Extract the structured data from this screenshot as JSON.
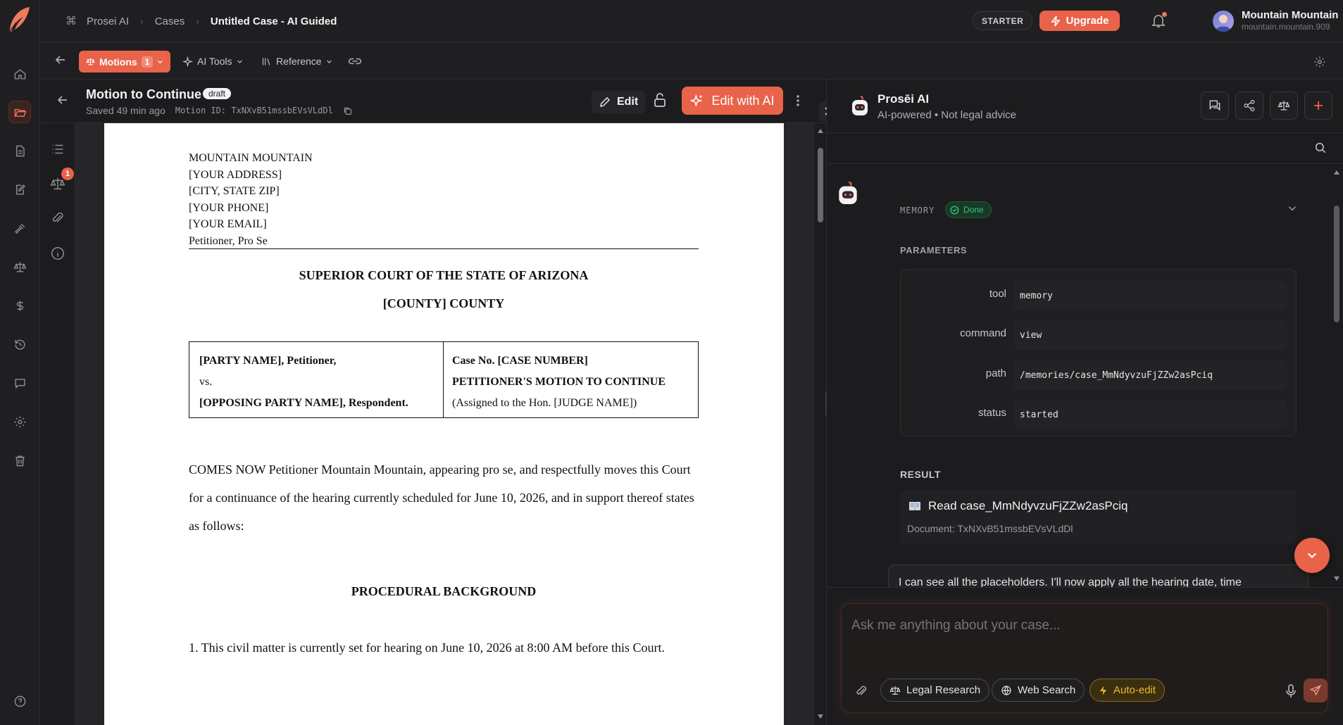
{
  "topbar": {
    "breadcrumbs": [
      "Prosei AI",
      "Cases",
      "Untitled Case - AI Guided"
    ],
    "plan_badge": "STARTER",
    "upgrade_label": "Upgrade",
    "user_name": "Mountain Mountain",
    "user_email": "mountain.mountain.909"
  },
  "toolbar": {
    "motions_label": "Motions",
    "motions_count": "1",
    "ai_tools_label": "AI Tools",
    "reference_label": "Reference"
  },
  "doc_header": {
    "title": "Motion to Continue",
    "status": "draft",
    "saved": "Saved 49 min ago",
    "motion_id": "Motion ID: TxNXvB51mssbEVsVLdDl",
    "edit_label": "Edit",
    "edit_ai_label": "Edit with AI"
  },
  "doc_side": {
    "badge": "1"
  },
  "document": {
    "address_lines": [
      "MOUNTAIN MOUNTAIN",
      "[YOUR ADDRESS]",
      "[CITY, STATE ZIP]",
      "[YOUR PHONE]",
      "[YOUR EMAIL]",
      "Petitioner, Pro Se"
    ],
    "court_line1": "SUPERIOR COURT OF THE STATE OF ARIZONA",
    "court_line2": "[COUNTY] COUNTY",
    "caption_left": [
      "[PARTY NAME], Petitioner,",
      "vs.",
      "[OPPOSING PARTY NAME], Respondent."
    ],
    "caption_right": [
      "Case No. [CASE NUMBER]",
      "PETITIONER'S MOTION TO CONTINUE",
      "(Assigned to the Hon. [JUDGE NAME])"
    ],
    "intro": "COMES NOW Petitioner Mountain Mountain, appearing pro se, and respectfully moves this Court for a continuance of the hearing currently scheduled for June 10, 2026, and in support thereof states as follows:",
    "section_heading": "PROCEDURAL BACKGROUND",
    "para1": "1. This civil matter is currently set for hearing on June 10, 2026 at 8:00 AM before this Court."
  },
  "ai_panel": {
    "title": "Prosēi AI",
    "subtitle": "AI-powered • Not legal advice",
    "memory_label": "MEMORY",
    "memory_status": "Done",
    "parameters_label": "PARAMETERS",
    "parameters": [
      {
        "key": "tool",
        "value": "memory"
      },
      {
        "key": "command",
        "value": "view"
      },
      {
        "key": "path",
        "value": "/memories/case_MmNdyvzuFjZZw2asPciq"
      },
      {
        "key": "status",
        "value": "started"
      }
    ],
    "result_label": "RESULT",
    "result_title": "Read case_MmNdyvzuFjZZw2asPciq",
    "result_sub": "Document: TxNXvB51mssbEVsVLdDl",
    "message_preview": "I can see all the placeholders. I'll now apply all the hearing date, time"
  },
  "composer": {
    "placeholder": "Ask me anything about your case...",
    "chips": [
      "Legal Research",
      "Web Search",
      "Auto-edit"
    ]
  },
  "colors": {
    "accent": "#e8634a",
    "success": "#3fc47a",
    "auto_edit": "#f2b532"
  }
}
